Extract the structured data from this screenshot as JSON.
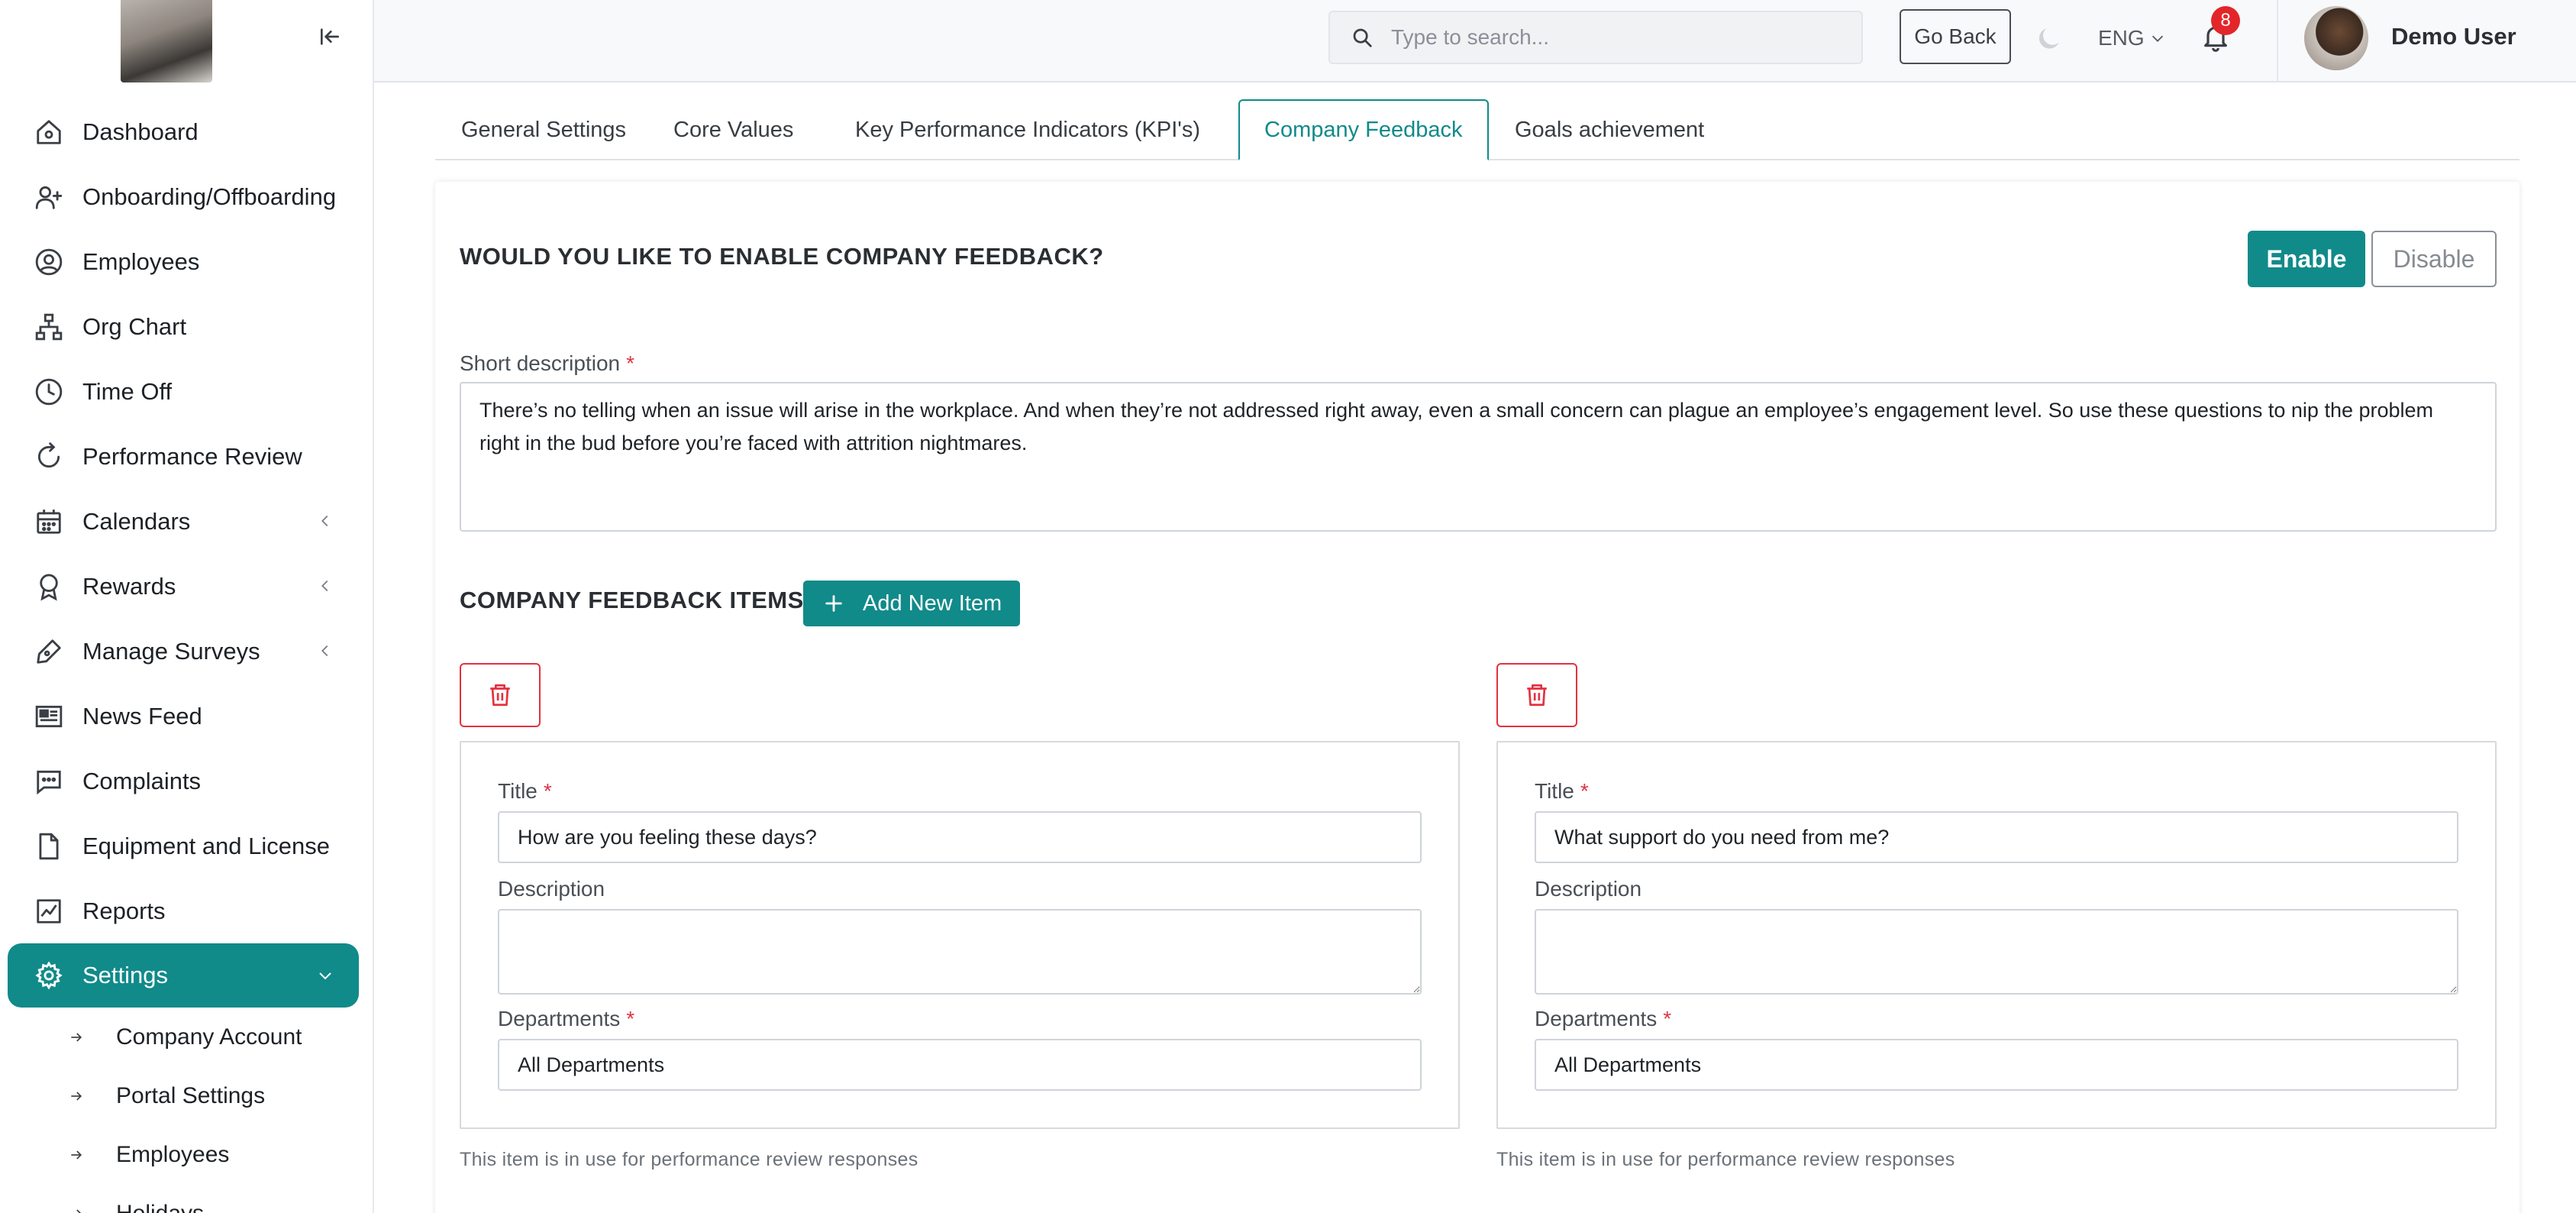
{
  "sidebar": {
    "items": [
      {
        "label": "Dashboard",
        "icon": "home-icon"
      },
      {
        "label": "Onboarding/Offboarding",
        "icon": "user-plus-icon"
      },
      {
        "label": "Employees",
        "icon": "user-circle-icon"
      },
      {
        "label": "Org Chart",
        "icon": "org-chart-icon"
      },
      {
        "label": "Time Off",
        "icon": "clock-icon"
      },
      {
        "label": "Performance Review",
        "icon": "refresh-icon"
      },
      {
        "label": "Calendars",
        "icon": "calendar-icon"
      },
      {
        "label": "Rewards",
        "icon": "award-icon"
      },
      {
        "label": "Manage Surveys",
        "icon": "pen-icon"
      },
      {
        "label": "News Feed",
        "icon": "newspaper-icon"
      },
      {
        "label": "Complaints",
        "icon": "chat-icon"
      },
      {
        "label": "Equipment and License",
        "icon": "file-icon"
      },
      {
        "label": "Reports",
        "icon": "chart-icon"
      },
      {
        "label": "Settings",
        "icon": "gear-icon"
      }
    ],
    "sub_items": [
      {
        "label": "Company Account"
      },
      {
        "label": "Portal Settings"
      },
      {
        "label": "Employees"
      },
      {
        "label": "Holidays"
      }
    ]
  },
  "header": {
    "search_placeholder": "Type to search...",
    "go_back": "Go Back",
    "language": "ENG",
    "notifications_count": "8",
    "user_name": "Demo User"
  },
  "tabs": [
    {
      "label": "General Settings"
    },
    {
      "label": "Core Values"
    },
    {
      "label": "Key Performance Indicators (KPI's)"
    },
    {
      "label": "Company Feedback",
      "active": true
    },
    {
      "label": "Goals achievement"
    }
  ],
  "feedback": {
    "question": "WOULD YOU LIKE TO ENABLE COMPANY FEEDBACK?",
    "enable_label": "Enable",
    "disable_label": "Disable",
    "short_desc_label": "Short description",
    "short_desc_value": "There’s no telling when an issue will arise in the workplace. And when they’re not addressed right away, even a small concern can plague an employee’s engagement level. So use these questions to nip the problem right in the bud before you’re faced with attrition nightmares.",
    "items_title": "COMPANY FEEDBACK ITEMS",
    "add_item_label": "Add New Item",
    "field_title_label": "Title",
    "field_description_label": "Description",
    "field_departments_label": "Departments",
    "items": [
      {
        "title": "How are you feeling these days?",
        "description": "",
        "departments": "All Departments",
        "usage_note": "This item is in use for performance review responses"
      },
      {
        "title": "What support do you need from me?",
        "description": "",
        "departments": "All Departments",
        "usage_note": "This item is in use for performance review responses"
      }
    ]
  },
  "colors": {
    "accent": "#118a8a",
    "danger": "#e4313e",
    "badge": "#e3262a"
  }
}
